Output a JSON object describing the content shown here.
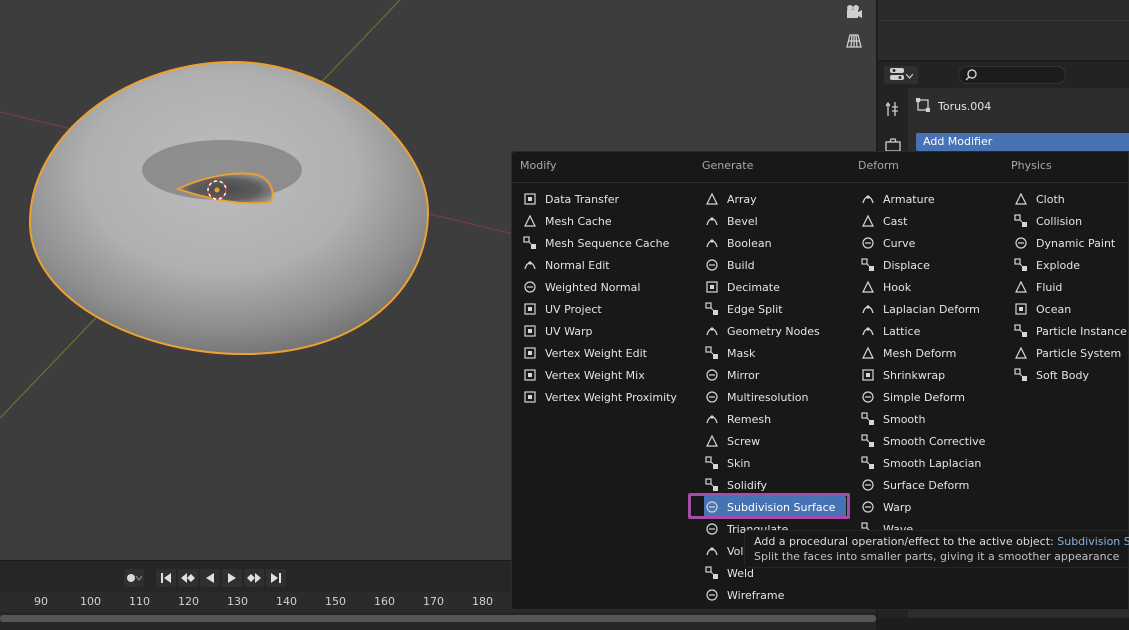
{
  "colors": {
    "accent": "#4772b3",
    "selection_outline": "#f0a030",
    "highlight_box": "#a54ca8",
    "tooltip_highlight": "#8aaedb"
  },
  "properties": {
    "object_name": "Torus.004",
    "add_modifier_label": "Add Modifier"
  },
  "menu": {
    "columns": [
      {
        "header": "Modify",
        "items": [
          {
            "label": "Data Transfer",
            "icon": "data-transfer-icon"
          },
          {
            "label": "Mesh Cache",
            "icon": "mesh-cache-icon"
          },
          {
            "label": "Mesh Sequence Cache",
            "icon": "mesh-sequence-cache-icon"
          },
          {
            "label": "Normal Edit",
            "icon": "normal-edit-icon"
          },
          {
            "label": "Weighted Normal",
            "icon": "weighted-normal-icon"
          },
          {
            "label": "UV Project",
            "icon": "uv-project-icon"
          },
          {
            "label": "UV Warp",
            "icon": "uv-warp-icon"
          },
          {
            "label": "Vertex Weight Edit",
            "icon": "vertex-weight-icon"
          },
          {
            "label": "Vertex Weight Mix",
            "icon": "vertex-weight-icon"
          },
          {
            "label": "Vertex Weight Proximity",
            "icon": "vertex-weight-icon"
          }
        ]
      },
      {
        "header": "Generate",
        "items": [
          {
            "label": "Array",
            "icon": "array-icon"
          },
          {
            "label": "Bevel",
            "icon": "bevel-icon"
          },
          {
            "label": "Boolean",
            "icon": "boolean-icon"
          },
          {
            "label": "Build",
            "icon": "build-icon"
          },
          {
            "label": "Decimate",
            "icon": "decimate-icon"
          },
          {
            "label": "Edge Split",
            "icon": "edge-split-icon"
          },
          {
            "label": "Geometry Nodes",
            "icon": "geometry-nodes-icon"
          },
          {
            "label": "Mask",
            "icon": "mask-icon"
          },
          {
            "label": "Mirror",
            "icon": "mirror-icon"
          },
          {
            "label": "Multiresolution",
            "icon": "multiresolution-icon"
          },
          {
            "label": "Remesh",
            "icon": "remesh-icon"
          },
          {
            "label": "Screw",
            "icon": "screw-icon"
          },
          {
            "label": "Skin",
            "icon": "skin-icon"
          },
          {
            "label": "Solidify",
            "icon": "solidify-icon"
          },
          {
            "label": "Subdivision Surface",
            "icon": "subdivision-surface-icon",
            "active": true
          },
          {
            "label": "Triangulate",
            "icon": "triangulate-icon"
          },
          {
            "label": "Volume to Mesh",
            "icon": "volume-icon"
          },
          {
            "label": "Weld",
            "icon": "weld-icon"
          },
          {
            "label": "Wireframe",
            "icon": "wireframe-icon"
          }
        ]
      },
      {
        "header": "Deform",
        "items": [
          {
            "label": "Armature",
            "icon": "armature-icon"
          },
          {
            "label": "Cast",
            "icon": "cast-icon"
          },
          {
            "label": "Curve",
            "icon": "curve-icon"
          },
          {
            "label": "Displace",
            "icon": "displace-icon"
          },
          {
            "label": "Hook",
            "icon": "hook-icon"
          },
          {
            "label": "Laplacian Deform",
            "icon": "laplacian-deform-icon"
          },
          {
            "label": "Lattice",
            "icon": "lattice-icon"
          },
          {
            "label": "Mesh Deform",
            "icon": "mesh-deform-icon"
          },
          {
            "label": "Shrinkwrap",
            "icon": "shrinkwrap-icon"
          },
          {
            "label": "Simple Deform",
            "icon": "simple-deform-icon"
          },
          {
            "label": "Smooth",
            "icon": "smooth-icon"
          },
          {
            "label": "Smooth Corrective",
            "icon": "smooth-icon"
          },
          {
            "label": "Smooth Laplacian",
            "icon": "smooth-icon"
          },
          {
            "label": "Surface Deform",
            "icon": "surface-deform-icon"
          },
          {
            "label": "Warp",
            "icon": "warp-icon"
          },
          {
            "label": "Wave",
            "icon": "wave-icon"
          }
        ]
      },
      {
        "header": "Physics",
        "items": [
          {
            "label": "Cloth",
            "icon": "cloth-icon"
          },
          {
            "label": "Collision",
            "icon": "collision-icon"
          },
          {
            "label": "Dynamic Paint",
            "icon": "dynamic-paint-icon"
          },
          {
            "label": "Explode",
            "icon": "explode-icon"
          },
          {
            "label": "Fluid",
            "icon": "fluid-icon"
          },
          {
            "label": "Ocean",
            "icon": "ocean-icon"
          },
          {
            "label": "Particle Instance",
            "icon": "particle-instance-icon"
          },
          {
            "label": "Particle System",
            "icon": "particle-system-icon"
          },
          {
            "label": "Soft Body",
            "icon": "soft-body-icon"
          }
        ]
      }
    ]
  },
  "tooltip": {
    "line1_prefix": "Add a procedural operation/effect to the active object:",
    "line1_highlight": "Subdivision Surface",
    "line2": "Split the faces into smaller parts, giving it a smoother appearance"
  },
  "timeline": {
    "ticks": [
      "90",
      "100",
      "110",
      "120",
      "130",
      "140",
      "150",
      "160",
      "170",
      "180"
    ]
  }
}
